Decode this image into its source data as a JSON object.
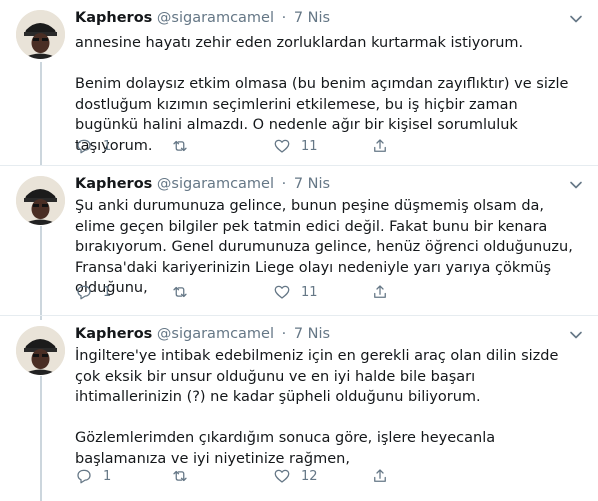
{
  "tweets": [
    {
      "name": "Kapheros",
      "handle": "@sigaramcamel",
      "separator": "·",
      "date": "7 Nis",
      "paragraphs": [
        "annesine hayatı zehir eden zorluklardan kurtarmak istiyorum.",
        "Benim dolaysız etkim olmasa (bu benim açımdan zayıflıktır) ve sizle dostluğum kızımın seçimlerini etkilemese, bu iş hiçbir zaman bugünkü halini almazdı. O nedenle ağır bir kişisel sorumluluk taşıyorum."
      ],
      "reply_count": "1",
      "retweet_count": "",
      "like_count": "11"
    },
    {
      "name": "Kapheros",
      "handle": "@sigaramcamel",
      "separator": "·",
      "date": "7 Nis",
      "paragraphs": [
        "Şu anki durumunuza gelince, bunun peşine düşmemiş olsam da, elime geçen bilgiler pek tatmin edici değil. Fakat bunu bir kenara bırakıyorum. Genel durumunuza gelince, henüz öğrenci olduğunuzu, Fransa'daki kariyerinizin Liege olayı nedeniyle yarı yarıya çökmüş olduğunu,"
      ],
      "reply_count": "1",
      "retweet_count": "",
      "like_count": "11"
    },
    {
      "name": "Kapheros",
      "handle": "@sigaramcamel",
      "separator": "·",
      "date": "7 Nis",
      "paragraphs": [
        "İngiltere'ye intibak edebilmeniz için en gerekli araç olan dilin sizde çok eksik bir unsur olduğunu ve en iyi halde bile başarı ihtimallerinizin (?) ne kadar şüpheli olduğunu biliyorum.",
        "Gözlemlerimden çıkardığım sonuca göre, işlere heyecanla başlamanıza ve iyi niyetinize rağmen,"
      ],
      "reply_count": "1",
      "retweet_count": "",
      "like_count": "12"
    }
  ],
  "icons": {
    "reply": "reply-icon",
    "retweet": "retweet-icon",
    "like": "heart-icon",
    "share": "share-icon",
    "caret": "chevron-down-icon",
    "avatar": "avatar"
  },
  "colors": {
    "text": "#14171a",
    "muted": "#657786",
    "thread_line": "#ccd6dd",
    "divider": "#e6ecf0"
  }
}
